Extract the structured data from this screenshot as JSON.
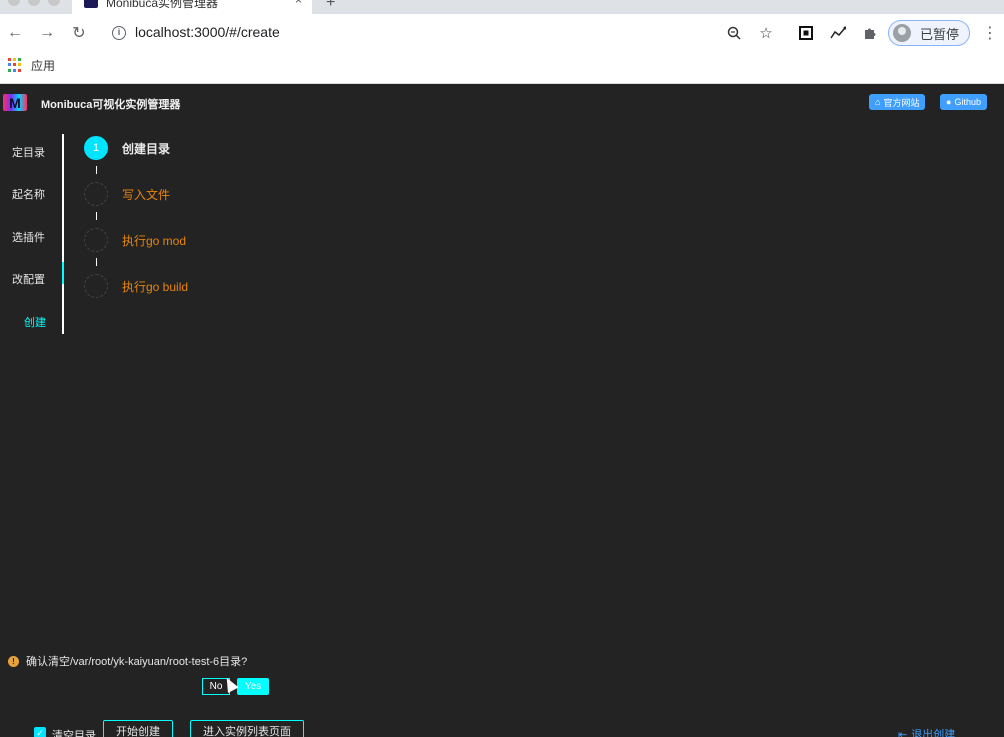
{
  "browser": {
    "tab_title": "Monibuca实例管理器",
    "tab_close": "×",
    "new_tab": "+",
    "url": "localhost:3000/#/create",
    "profile_label": "已暂停",
    "bookmarks_apps_label": "应用"
  },
  "header": {
    "title": "Monibuca可视化实例管理器",
    "logo_letter": "M",
    "official_site_label": "官方网站",
    "github_label": "Github"
  },
  "sidebar": {
    "items": [
      {
        "label": "定目录"
      },
      {
        "label": "起名称"
      },
      {
        "label": "选插件"
      },
      {
        "label": "改配置"
      },
      {
        "label": "创建"
      }
    ]
  },
  "steps": [
    {
      "number": "1",
      "label": "创建目录",
      "status": "active"
    },
    {
      "number": "",
      "label": "写入文件",
      "status": "wait"
    },
    {
      "number": "",
      "label": "执行go mod",
      "status": "wait"
    },
    {
      "number": "",
      "label": "执行go build",
      "status": "wait"
    }
  ],
  "confirm": {
    "warn_symbol": "!",
    "text": "确认清空/var/root/yk-kaiyuan/root-test-6目录?",
    "no_label": "No",
    "yes_label": "Yes"
  },
  "footer": {
    "checkbox_label": "清空目录",
    "checkbox_checked": true,
    "start_button": "开始创建",
    "instance_list_button": "进入实例列表页面",
    "exit_label": "退出创建"
  },
  "colors": {
    "accent": "#00e5ff",
    "step_wait": "#e6850e",
    "link_blue": "#409eff",
    "background": "#232323"
  }
}
